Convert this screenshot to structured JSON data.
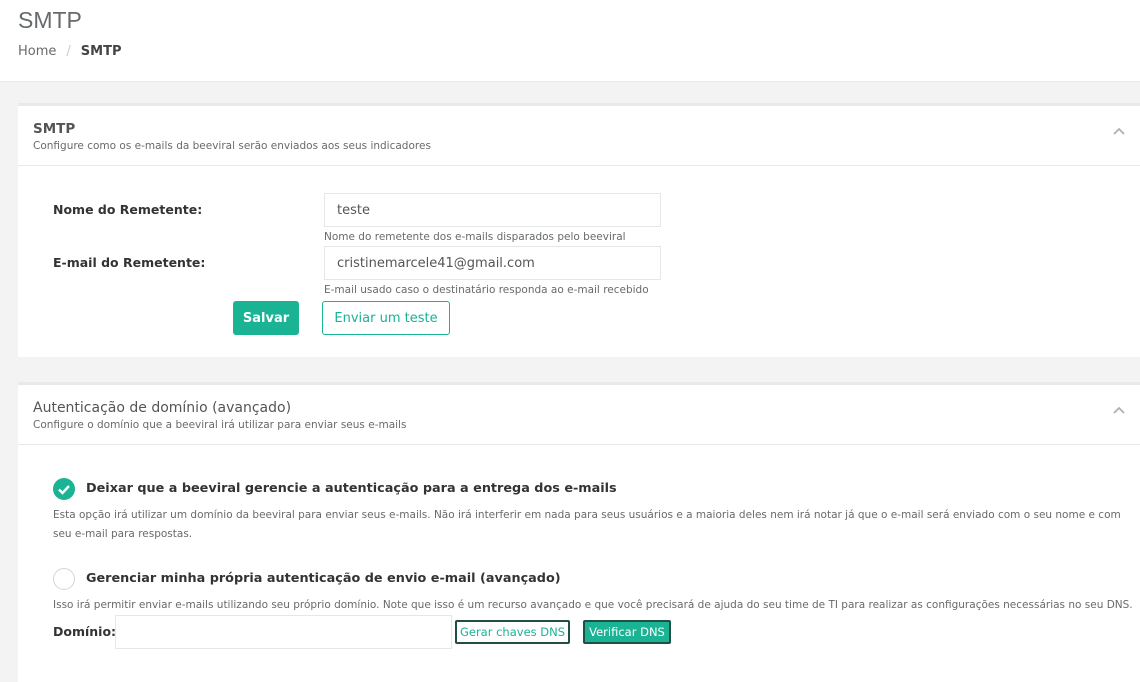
{
  "header": {
    "title": "SMTP",
    "breadcrumb": {
      "home": "Home",
      "separator": "/",
      "current": "SMTP"
    }
  },
  "smtp_panel": {
    "title": "SMTP",
    "subtitle": "Configure como os e-mails da beeviral serão enviados aos seus indicadores",
    "sender_name": {
      "label": "Nome do Remetente:",
      "value": "teste",
      "help": "Nome do remetente dos e-mails disparados pelo beeviral"
    },
    "sender_email": {
      "label": "E-mail do Remetente:",
      "value": "cristinemarcele41@gmail.com",
      "help": "E-mail usado caso o destinatário responda ao e-mail recebido"
    },
    "save_label": "Salvar",
    "test_label": "Enviar um teste"
  },
  "domain_panel": {
    "title": "Autenticação de domínio (avançado)",
    "subtitle": "Configure o domínio que a beeviral irá utilizar para enviar seus e-mails",
    "option1": {
      "label": "Deixar que a beeviral gerencie a autenticação para a entrega dos e-mails",
      "desc_line1": "Esta opção irá utilizar um domínio da beeviral para enviar seus e-mails. Não irá interferir em nada para seus usuários e a maioria deles nem irá notar já que o e-mail será enviado com o seu nome e com",
      "desc_line2": "seu e-mail para respostas.",
      "checked": true
    },
    "option2": {
      "label": "Gerenciar minha própria autenticação de envio e-mail (avançado)",
      "desc": "Isso irá permitir enviar e-mails utilizando seu próprio domínio. Note que isso é um recurso avançado e que você precisará de ajuda do seu time de TI para realizar as configurações necessárias no seu DNS.",
      "checked": false
    },
    "domain_label": "Domínio:",
    "domain_value": "",
    "generate_label": "Gerar chaves DNS",
    "verify_label": "Verificar DNS"
  },
  "colors": {
    "accent": "#1ab394",
    "background": "#f3f3f4"
  }
}
